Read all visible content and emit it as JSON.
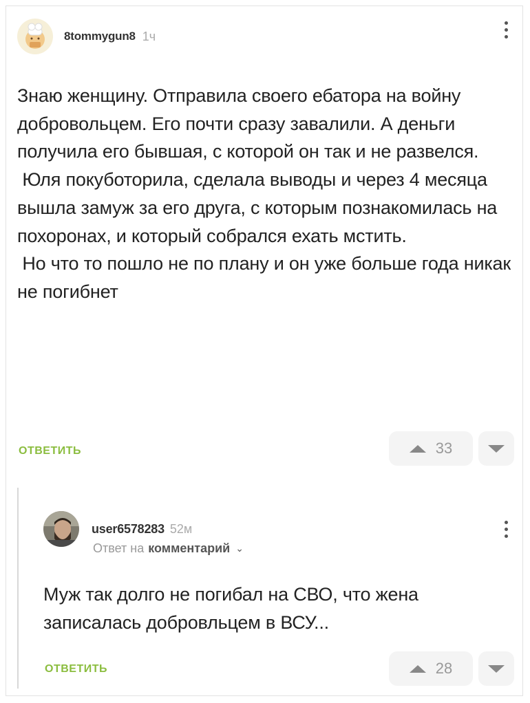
{
  "comment": {
    "username": "8tommygun8",
    "time": "1ч",
    "text": "Знаю женщину. Отправила своего ебатора на войну добровольцем. Его почти сразу завалили. А деньги получила его бывшая, с которой он так и не развелся.\n Юля покуботорила, сделала выводы и через 4 месяца вышла замуж за его друга, с которым познакомилась на похоронах, и который собрался ехать мстить.\n Но что то пошло не по плану и он уже больше года никак не погибнет",
    "reply_label": "ОТВЕТИТЬ",
    "rating": "33",
    "up_icon": "triangle-up-icon",
    "down_icon": "triangle-down-icon",
    "menu_icon": "vertical-dots-icon"
  },
  "reply": {
    "username": "user6578283",
    "time": "52м",
    "reply_to_prefix": "Ответ на",
    "reply_to_target": "комментарий",
    "chevron": "⌄",
    "text": "Муж так долго не погибал на СВО, что жена записалась добровльцем в ВСУ...",
    "reply_label": "ОТВЕТИТЬ",
    "rating": "28"
  },
  "colors": {
    "accent_green": "#8bbd3f",
    "muted_text": "#999999",
    "vote_bg": "#f4f4f4",
    "thread_line": "#d8d8d8"
  }
}
